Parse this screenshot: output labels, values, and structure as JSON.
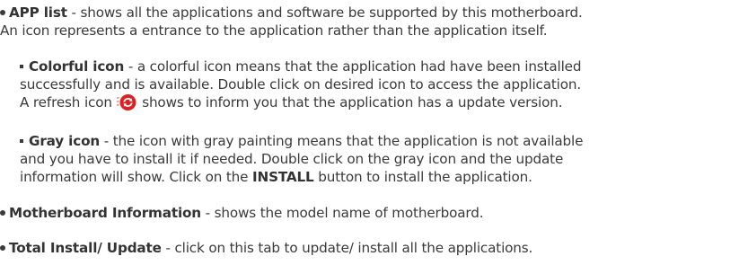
{
  "app_list": {
    "heading": "APP list",
    "line1_rest": " - shows all the applications and software be supported by this motherboard.",
    "line2": "An icon represents a entrance to the application rather than the application itself."
  },
  "colorful_icon": {
    "heading": "Colorful icon",
    "line1_rest": " - a colorful icon means that the application had have been installed",
    "line2": "successfully and is available. Double click on desired icon to access the application.",
    "line3_before": "A refresh icon ",
    "line3_after": " shows to inform you that the application has a update version.",
    "icon": "refresh-icon",
    "icon_color": "#e02020"
  },
  "gray_icon": {
    "heading": "Gray icon",
    "line1_rest": " - the icon with gray painting means that the application is not available",
    "line2": "and you have to install it if needed. Double click on the gray icon and the update",
    "line3_before": "information will show. Click on the ",
    "line3_bold": "INSTALL",
    "line3_after": " button to install the application."
  },
  "motherboard_info": {
    "heading": "Motherboard Information",
    "rest": " - shows the model name of motherboard."
  },
  "total_install": {
    "heading": "Total Install/ Update",
    "rest": " - click on this tab to update/ install all the applications."
  },
  "colors": {
    "text": "#3a3a3a"
  }
}
